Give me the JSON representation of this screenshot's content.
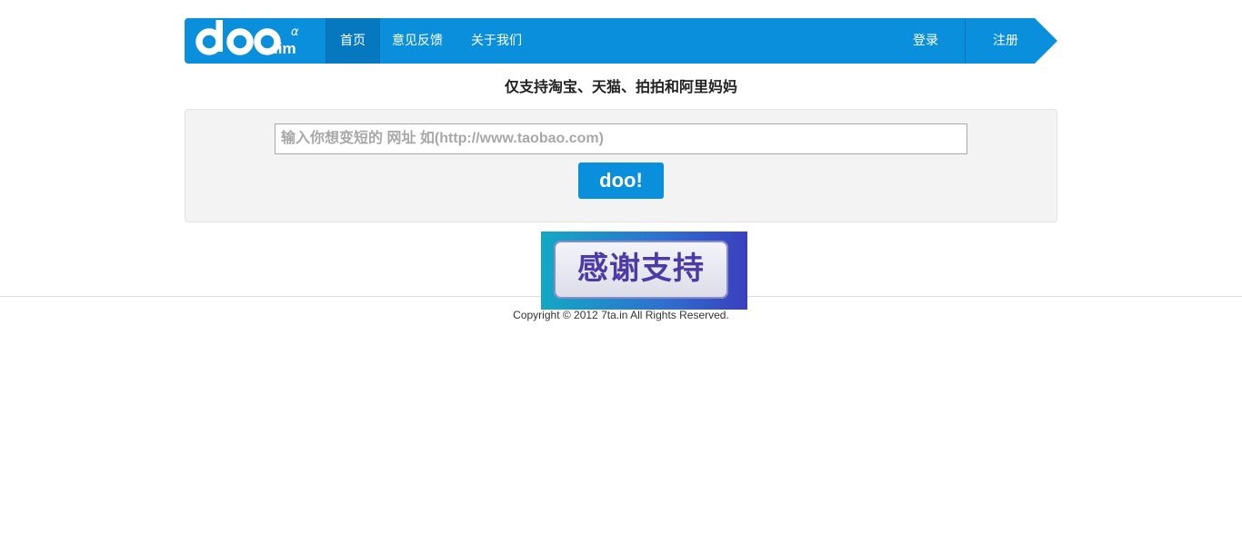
{
  "nav": {
    "logo_text": "doo",
    "logo_suffix": ".im",
    "logo_superscript": "α",
    "home_label": "首页",
    "feedback_label": "意见反馈",
    "about_label": "关于我们",
    "login_label": "登录",
    "register_label": "注册"
  },
  "subtitle": "仅支持淘宝、天猫、拍拍和阿里妈妈",
  "form": {
    "url_placeholder": "输入你想变短的 网址 如(http://www.taobao.com)",
    "url_value": "",
    "submit_label": "doo!"
  },
  "banner": {
    "text": "感谢支持"
  },
  "footer": {
    "copyright": "Copyright © 2012 7ta.in All Rights Reserved."
  },
  "colors": {
    "brand": "#0a8fdc",
    "nav_active": "#0678c0",
    "panel_bg": "#f3f3f3"
  }
}
